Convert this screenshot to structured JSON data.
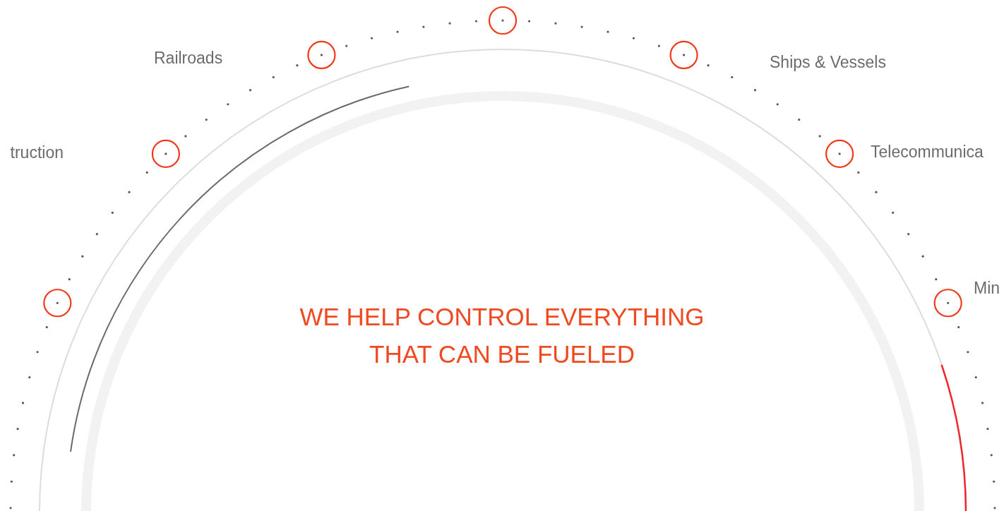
{
  "sector_labels": [
    {
      "text": "truction"
    },
    {
      "text": "Railroads"
    },
    {
      "text": "Ships & Vessels"
    },
    {
      "text": "Telecommunica"
    },
    {
      "text": "Min"
    }
  ],
  "headline_lines": [
    "WE HELP CONTROL EVERYTHING",
    "THAT CAN BE FUELED"
  ]
}
